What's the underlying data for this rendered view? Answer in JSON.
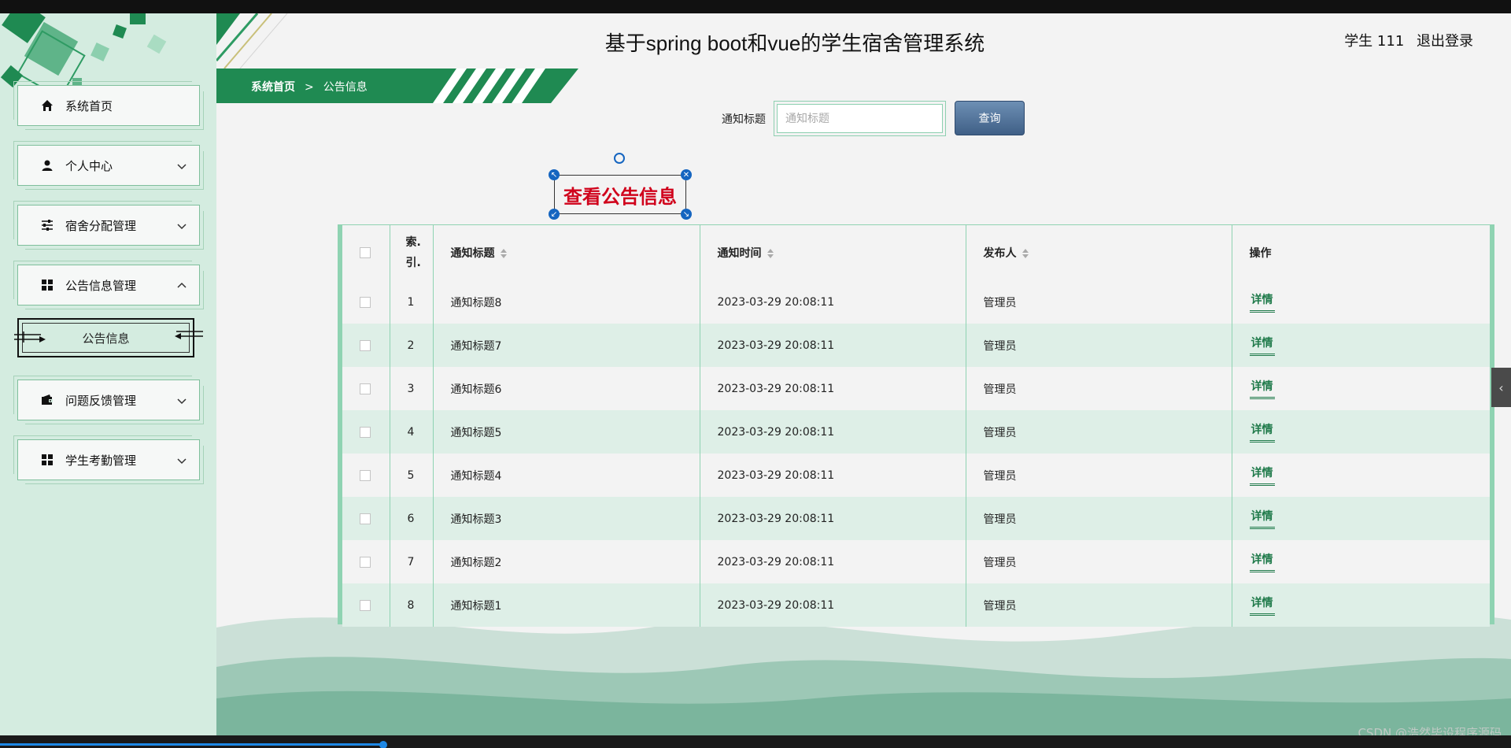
{
  "header": {
    "title": "基于spring boot和vue的学生宿舍管理系统",
    "user": "学生 111",
    "logout": "退出登录"
  },
  "breadcrumb": {
    "home": "系统首页",
    "separator": ">",
    "current": "公告信息"
  },
  "sidebar": {
    "items": [
      {
        "label": "系统首页",
        "icon": "home-icon"
      },
      {
        "label": "个人中心",
        "icon": "user-icon"
      },
      {
        "label": "宿舍分配管理",
        "icon": "sliders-icon"
      },
      {
        "label": "公告信息管理",
        "icon": "grid-icon"
      },
      {
        "label": "问题反馈管理",
        "icon": "wallet-icon"
      },
      {
        "label": "学生考勤管理",
        "icon": "grid-icon"
      }
    ],
    "sub_item": "公告信息"
  },
  "search": {
    "label": "通知标题",
    "placeholder": "通知标题",
    "button": "查询"
  },
  "caption": "查看公告信息",
  "table": {
    "headers": {
      "index_line1": "索.",
      "index_line2": "引.",
      "title": "通知标题",
      "time": "通知时间",
      "publisher": "发布人",
      "action": "操作"
    },
    "rows": [
      {
        "index": "1",
        "title": "通知标题8",
        "time": "2023-03-29 20:08:11",
        "publisher": "管理员",
        "action": "详情"
      },
      {
        "index": "2",
        "title": "通知标题7",
        "time": "2023-03-29 20:08:11",
        "publisher": "管理员",
        "action": "详情"
      },
      {
        "index": "3",
        "title": "通知标题6",
        "time": "2023-03-29 20:08:11",
        "publisher": "管理员",
        "action": "详情"
      },
      {
        "index": "4",
        "title": "通知标题5",
        "time": "2023-03-29 20:08:11",
        "publisher": "管理员",
        "action": "详情"
      },
      {
        "index": "5",
        "title": "通知标题4",
        "time": "2023-03-29 20:08:11",
        "publisher": "管理员",
        "action": "详情"
      },
      {
        "index": "6",
        "title": "通知标题3",
        "time": "2023-03-29 20:08:11",
        "publisher": "管理员",
        "action": "详情"
      },
      {
        "index": "7",
        "title": "通知标题2",
        "time": "2023-03-29 20:08:11",
        "publisher": "管理员",
        "action": "详情"
      },
      {
        "index": "8",
        "title": "通知标题1",
        "time": "2023-03-29 20:08:11",
        "publisher": "管理员",
        "action": "详情"
      }
    ]
  },
  "watermark": "CSDN @浩然毕设程序源码",
  "colors": {
    "sidebar_bg": "#d4ece0",
    "accent_green": "#1f8a52",
    "caption_red": "#d0021b",
    "button_blue": "#3f5f86"
  }
}
